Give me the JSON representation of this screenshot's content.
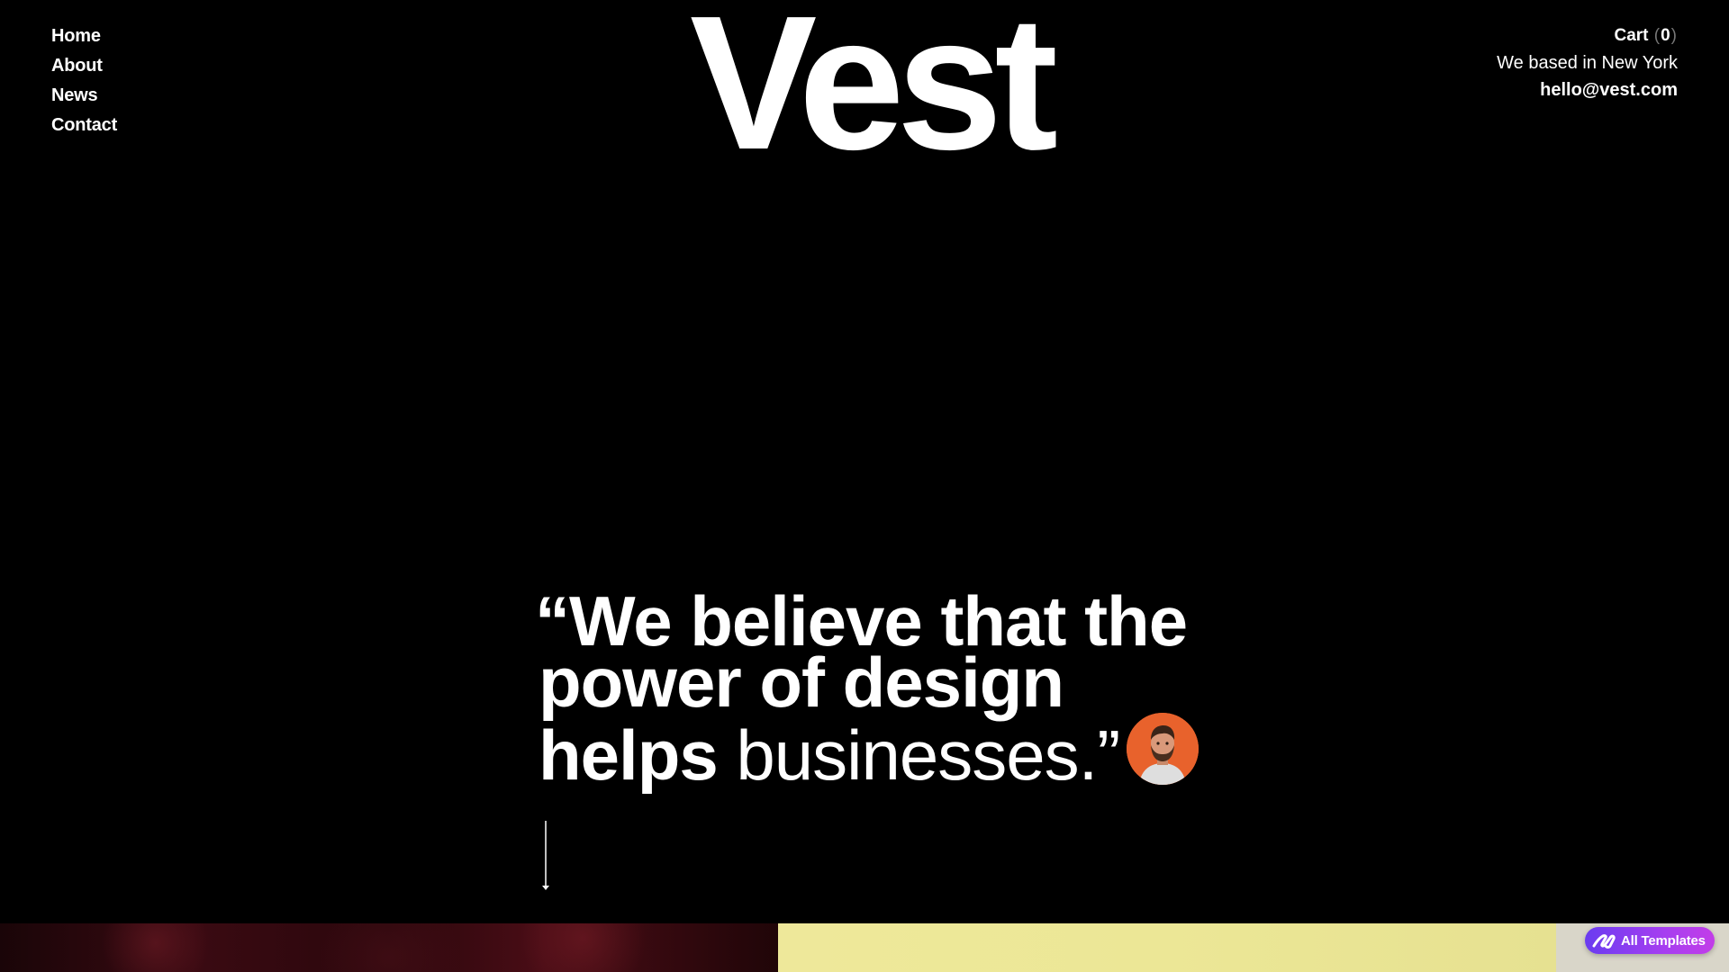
{
  "nav": {
    "items": [
      {
        "label": "Home"
      },
      {
        "label": "About"
      },
      {
        "label": "News"
      },
      {
        "label": "Contact"
      }
    ]
  },
  "logo": {
    "text": "Vest"
  },
  "info": {
    "cart_label": "Cart",
    "cart_count": "0",
    "location": "We based in New York",
    "email": "hello@vest.com"
  },
  "quote": {
    "line1": "“We believe that the",
    "line2": "power of design",
    "line3_bold": "helps",
    "line3_light": "businesses.”"
  },
  "badge": {
    "label": "All Templates"
  },
  "colors": {
    "background": "#000000",
    "text": "#ffffff",
    "avatar_bg": "#e8622c",
    "badge_start": "#6a3cf0",
    "badge_end": "#c23de8",
    "strip_yellow": "#eee89a"
  }
}
